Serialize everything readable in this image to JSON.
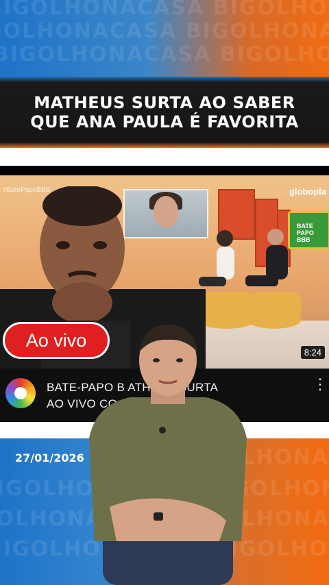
{
  "watermark_text": "BIGOLHONACASA BIGOLHONACASA BIGOLHONACASA",
  "headline": {
    "line1": "MATHEUS SURTA AO SABER",
    "line2": "QUE ANA PAULA É FAVORITA"
  },
  "video": {
    "hashtag": "#BatePapoBBB",
    "network_logo": "globopla",
    "bbb_screen_label": "BATE PAPO BBB",
    "live_badge": "Ao vivo",
    "duration": "8:24"
  },
  "youtube_item": {
    "channel_icon": "globo-channel-avatar",
    "title_line1": "BATE-PAPO B    ATHEUS SURTA",
    "title_line2": "AO VIVO CO          A FAVORITA ...",
    "menu_icon": "kebab-menu-icon"
  },
  "date": "27/01/2026",
  "colors": {
    "gradient_blue": "#1e73c8",
    "gradient_orange": "#f06b12",
    "live_red": "#e02020",
    "title_band": "#161616"
  }
}
